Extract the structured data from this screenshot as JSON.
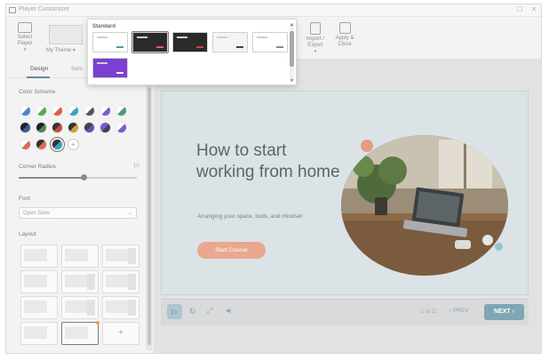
{
  "window": {
    "title": "Player Customizer",
    "maximize_glyph": "☐",
    "close_glyph": "✕"
  },
  "toolbar": {
    "select_player_label": "Select Player",
    "theme_label": "My Theme",
    "import_export_label": "Import / Export",
    "apply_close_label": "Apply & Close"
  },
  "theme_popup": {
    "section_title": "Standard",
    "thumbnails": [
      {
        "bg": "#ffffff",
        "btn": "#5f8fa8",
        "selected": false
      },
      {
        "bg": "#2a2a2a",
        "btn": "#e06060",
        "selected": true
      },
      {
        "bg": "#2a2a2a",
        "btn": "#d04040",
        "selected": false
      },
      {
        "bg": "#f4f4f4",
        "btn": "#444444",
        "selected": false
      },
      {
        "bg": "#ffffff",
        "btn": "#8a8a8a",
        "selected": false
      },
      {
        "bg": "#7b3fd1",
        "btn": "#ffffff",
        "selected": false
      }
    ],
    "scroll_up": "▲",
    "scroll_down": "▼"
  },
  "left_panel": {
    "tabs": [
      "Design",
      "Sets"
    ],
    "color_scheme_label": "Color Scheme",
    "corner_radius_label": "Corner Radius",
    "corner_radius_value": "10",
    "corner_radius_fraction": 0.55,
    "font_label": "Font",
    "font_value": "Open Sans",
    "layout_label": "Layout",
    "add_glyph": "+",
    "swatch_colors": [
      [
        "#4f7fd6",
        "#ffffff"
      ],
      [
        "#5aa84f",
        "#ffffff"
      ],
      [
        "#e05a4b",
        "#ffffff"
      ],
      [
        "#2fa6b8",
        "#ffffff"
      ],
      [
        "#555555",
        "#ffffff"
      ],
      [
        "#7b5ad6",
        "#ffffff"
      ],
      [
        "#49a06a",
        "#ffffff"
      ],
      [
        "#3c5a9a",
        "#222222"
      ],
      [
        "#4a8a56",
        "#222222"
      ],
      [
        "#c74a3a",
        "#333333"
      ],
      [
        "#c7a23a",
        "#333333"
      ],
      [
        "#6a4ab8",
        "#444444"
      ],
      [
        "#444444",
        "#7b5ad6"
      ],
      [
        "#7b5ad6",
        "#ffffff"
      ],
      [
        "#e06a5a",
        "#ffffff"
      ],
      [
        "#e06a5a",
        "#333333"
      ],
      [
        "#2fa6b8",
        "#333333"
      ]
    ]
  },
  "slide": {
    "title": "How to start working from home",
    "subtitle": "Arranging your space, tools, and mindset",
    "button_label": "Start Course"
  },
  "player": {
    "play_glyph": "▷",
    "replay_glyph": "↻",
    "fullscreen_glyph": "⤢",
    "volume_glyph": "◀)",
    "pager": "1 of 21",
    "prev_label": "‹  PREV",
    "next_label": "NEXT  ›"
  }
}
